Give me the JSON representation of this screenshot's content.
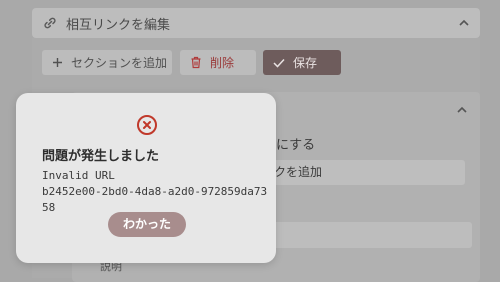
{
  "panel": {
    "title": "相互リンクを編集"
  },
  "toolbar": {
    "add_section_label": "セクションを追加",
    "delete_label": "削除",
    "save_label": "保存"
  },
  "section": {
    "checkbox_label_visible": "うにする",
    "add_link_label_visible": "ンクを追加",
    "description_label_visible": "説明"
  },
  "modal": {
    "title": "問題が発生しました",
    "message_line1": "Invalid URL",
    "message_line2": "b2452e00-2bd0-4da8-a2d0-972859da7358",
    "ok_label": "わかった"
  },
  "colors": {
    "accent": "#a88d8d",
    "error_icon": "#c0392b",
    "save_button": "#6e5c5c",
    "delete_text": "#9a3a3a"
  },
  "icons": [
    "link-icon",
    "chevron-up-icon",
    "plus-icon",
    "trash-icon",
    "check-icon",
    "error-circle-icon"
  ]
}
